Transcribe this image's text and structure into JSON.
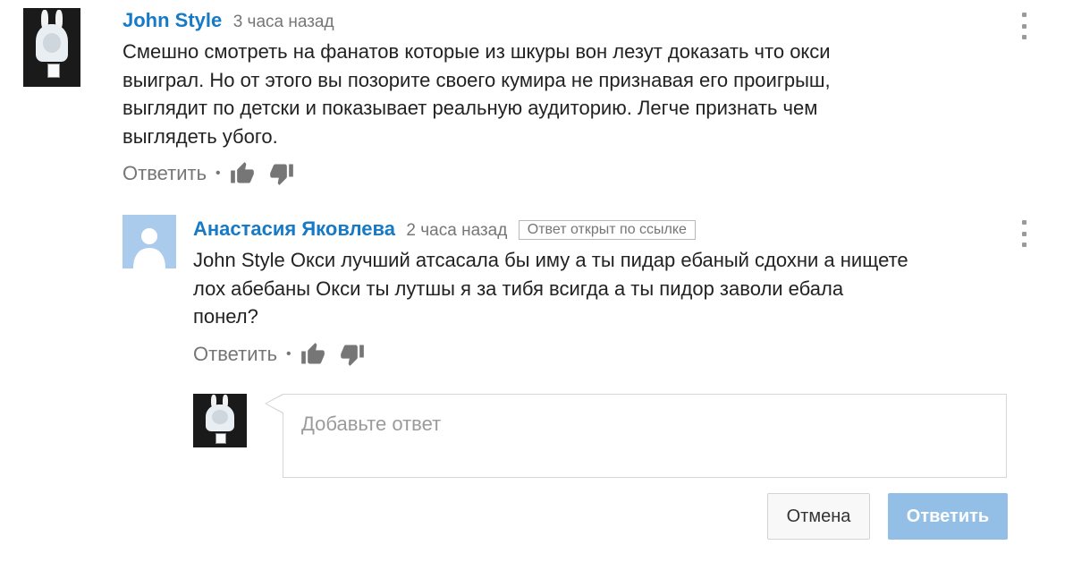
{
  "comment": {
    "author": "John Style",
    "time": "3 часа назад",
    "text_lines": [
      "Смешно смотреть на фанатов которые из шкуры вон лезут доказать что окси",
      "выиграл. Но от этого вы позорите своего кумира не признавая его проигрыш,",
      "выглядит по детски и показывает реальную аудиторию. Легче признать чем",
      "выглядеть убого."
    ],
    "reply_label": "Ответить",
    "separator": "•"
  },
  "reply": {
    "author": "Анастасия Яковлева",
    "time": "2 часа назад",
    "badge": "Ответ открыт по ссылке",
    "text_lines": [
      "John Style  Окси лучший атсасала бы иму а ты пидар ебаный сдохни а нищете",
      "лох абебаны Окси ты лутшы я за тибя всигда а ты пидор заволи ебала",
      "понел?"
    ],
    "reply_label": "Ответить",
    "separator": "•"
  },
  "composer": {
    "placeholder": "Добавьте ответ",
    "cancel_label": "Отмена",
    "submit_label": "Ответить"
  },
  "icons": {
    "like": "thumbs-up-icon",
    "dislike": "thumbs-down-icon",
    "menu": "more-vertical-icon",
    "default_avatar": "user-silhouette-icon"
  },
  "colors": {
    "author_link": "#167ac6",
    "meta_text": "#767676",
    "submit_disabled": "#93bfe6",
    "default_avatar_bg": "#aacbec"
  }
}
